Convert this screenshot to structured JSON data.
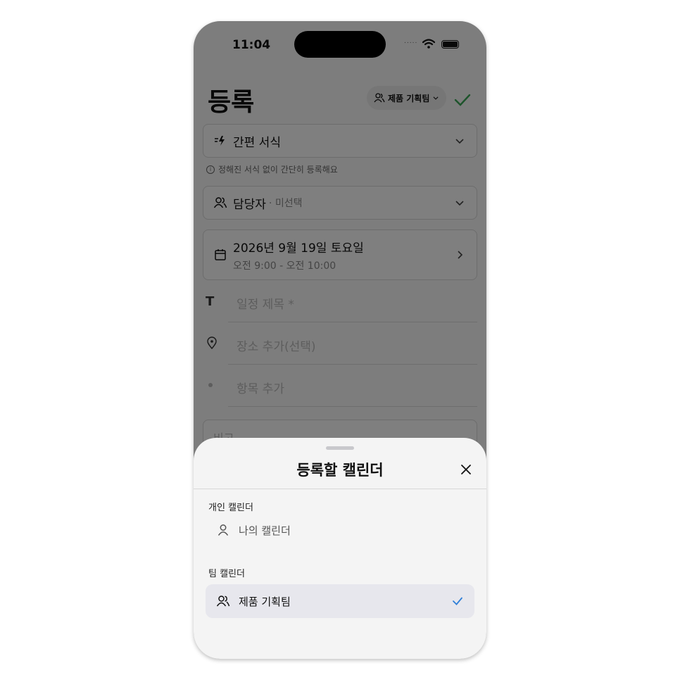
{
  "status_bar": {
    "time": "11:04",
    "signal": "....."
  },
  "header": {
    "title": "등록",
    "team_selector": "제품 기획팀"
  },
  "form": {
    "format": {
      "label": "간편 서식",
      "hint": "정해진 서식 없이 간단히 등록해요"
    },
    "assignee": {
      "label": "담당자",
      "value": "· 미선택"
    },
    "datetime": {
      "date": "2026년 9월 19일 토요일",
      "time": "오전 9:00 - 오전 10:00"
    },
    "title_placeholder": "일정 제목 *",
    "location_placeholder": "장소 추가(선택)",
    "item_placeholder": "항목 추가",
    "memo_placeholder": "비고"
  },
  "sheet": {
    "title": "등록할 캘린더",
    "personal_section": "개인 캘린더",
    "personal_items": [
      {
        "label": "나의 캘린더",
        "selected": false
      }
    ],
    "team_section": "팀 캘린더",
    "team_items": [
      {
        "label": "제품 기획팀",
        "selected": true
      }
    ]
  },
  "colors": {
    "accent": "#2f7fd8",
    "confirm": "#3aa857",
    "selected_bg": "#e7e7ed"
  }
}
